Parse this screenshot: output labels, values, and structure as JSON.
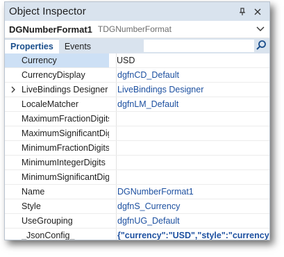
{
  "window": {
    "title": "Object Inspector",
    "pin_icon": "pin-icon",
    "close_icon": "close-icon"
  },
  "selector": {
    "component_name": "DGNumberFormat1",
    "component_type": "TDGNumberFormat",
    "dropdown_icon": "chevron-down-icon"
  },
  "tabs": [
    {
      "label": "Properties",
      "active": true
    },
    {
      "label": "Events",
      "active": false
    }
  ],
  "search": {
    "value": "",
    "icon": "search-icon"
  },
  "properties": [
    {
      "name": "Currency",
      "value": "USD",
      "selected": true
    },
    {
      "name": "CurrencyDisplay",
      "value": "dgfnCD_Default"
    },
    {
      "name": "LiveBindings Designer",
      "value": "LiveBindings Designer",
      "expandable": true
    },
    {
      "name": "LocaleMatcher",
      "value": "dgfnLM_Default"
    },
    {
      "name": "MaximumFractionDigits",
      "value": ""
    },
    {
      "name": "MaximumSignificantDigits",
      "value": ""
    },
    {
      "name": "MinimumFractionDigits",
      "value": ""
    },
    {
      "name": "MinimumIntegerDigits",
      "value": ""
    },
    {
      "name": "MinimumSignificantDigits",
      "value": ""
    },
    {
      "name": "Name",
      "value": "DGNumberFormat1"
    },
    {
      "name": "Style",
      "value": "dgfnS_Currency"
    },
    {
      "name": "UseGrouping",
      "value": "dgfnUG_Default"
    },
    {
      "name": "_JsonConfig_",
      "value": "{\"currency\":\"USD\",\"style\":\"currency\"}",
      "bold": true
    }
  ],
  "colors": {
    "titlebar_bg": "#d9e3ee",
    "value_text": "#1d50a0",
    "selected_bg": "#cde0f5",
    "active_tab_text": "#1a4e8c"
  }
}
